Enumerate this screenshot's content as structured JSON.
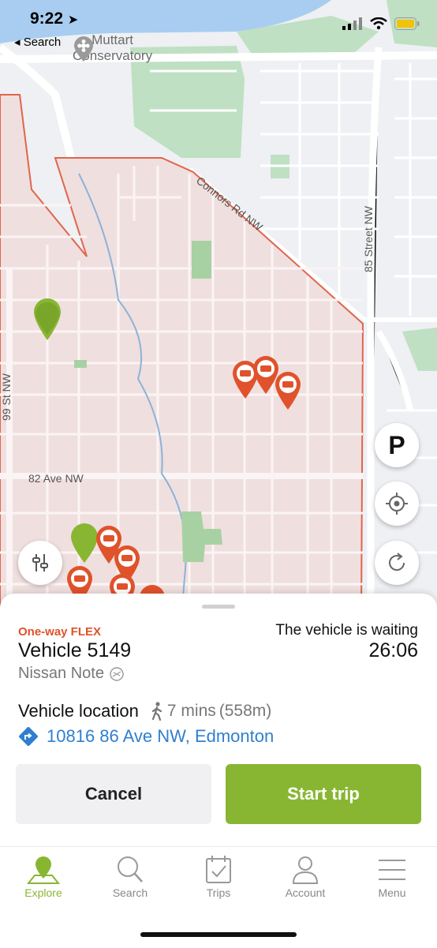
{
  "status_bar": {
    "time": "9:22",
    "back_label": "◂ Search"
  },
  "map": {
    "poi_name_line1": "Muttart",
    "poi_name_line2": "Conservatory",
    "streets": [
      "Connors Rd NW",
      "85 Street NW",
      "99 St NW",
      "82 Ave NW"
    ]
  },
  "map_controls": {
    "parking_label": "P"
  },
  "sheet": {
    "trip_type": "One-way FLEX",
    "vehicle_name": "Vehicle 5149",
    "vehicle_model": "Nissan Note",
    "waiting_label": "The vehicle is waiting",
    "countdown": "26:06",
    "location_label": "Vehicle location",
    "walk_time": "7 mins",
    "walk_distance": "(558m)",
    "address": "10816 86 Ave NW, Edmonton",
    "cancel_label": "Cancel",
    "start_label": "Start trip"
  },
  "tabs": [
    {
      "label": "Explore",
      "icon": "map-pin-icon",
      "active": true
    },
    {
      "label": "Search",
      "icon": "search-icon",
      "active": false
    },
    {
      "label": "Trips",
      "icon": "calendar-check-icon",
      "active": false
    },
    {
      "label": "Account",
      "icon": "person-icon",
      "active": false
    },
    {
      "label": "Menu",
      "icon": "menu-icon",
      "active": false
    }
  ],
  "colors": {
    "accent_green": "#88b632",
    "accent_orange": "#e0522b",
    "link_blue": "#2f7fd0",
    "zone_fill": "#f0dfdf"
  }
}
